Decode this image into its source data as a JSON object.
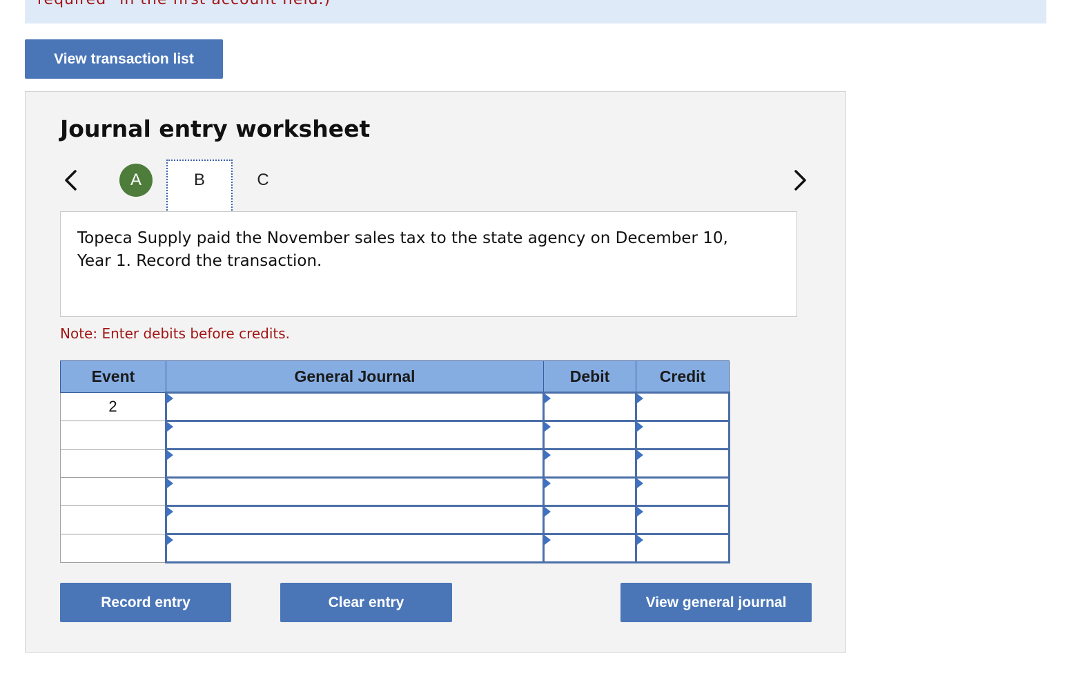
{
  "banner": {
    "text": "required\" in the first account field.)"
  },
  "toolbar": {
    "view_transaction_list_label": "View transaction list"
  },
  "worksheet": {
    "title": "Journal entry worksheet",
    "tabs": [
      {
        "label": "A",
        "state": "completed"
      },
      {
        "label": "B",
        "state": "active"
      },
      {
        "label": "C",
        "state": "inactive"
      }
    ],
    "description": "Topeca Supply paid the November sales tax to the state agency on December 10, Year 1. Record the transaction.",
    "note": "Note: Enter debits before credits.",
    "table": {
      "headers": [
        "Event",
        "General Journal",
        "Debit",
        "Credit"
      ],
      "rows": [
        {
          "event": "2",
          "account": "",
          "debit": "",
          "credit": ""
        },
        {
          "event": "",
          "account": "",
          "debit": "",
          "credit": ""
        },
        {
          "event": "",
          "account": "",
          "debit": "",
          "credit": ""
        },
        {
          "event": "",
          "account": "",
          "debit": "",
          "credit": ""
        },
        {
          "event": "",
          "account": "",
          "debit": "",
          "credit": ""
        },
        {
          "event": "",
          "account": "",
          "debit": "",
          "credit": ""
        }
      ]
    },
    "buttons": {
      "record_label": "Record entry",
      "clear_label": "Clear entry",
      "view_general_journal_label": "View general journal"
    }
  },
  "colors": {
    "button_bg": "#4a76b8",
    "header_bg": "#85ade2",
    "note_red": "#a31515",
    "completed_tab": "#4d7c3b",
    "panel_bg": "#f3f3f3",
    "banner_bg": "#deeaf8"
  },
  "icons": {
    "prev": "chevron-left-icon",
    "next": "chevron-right-icon",
    "cell_marker": "dropdown-marker-icon"
  }
}
